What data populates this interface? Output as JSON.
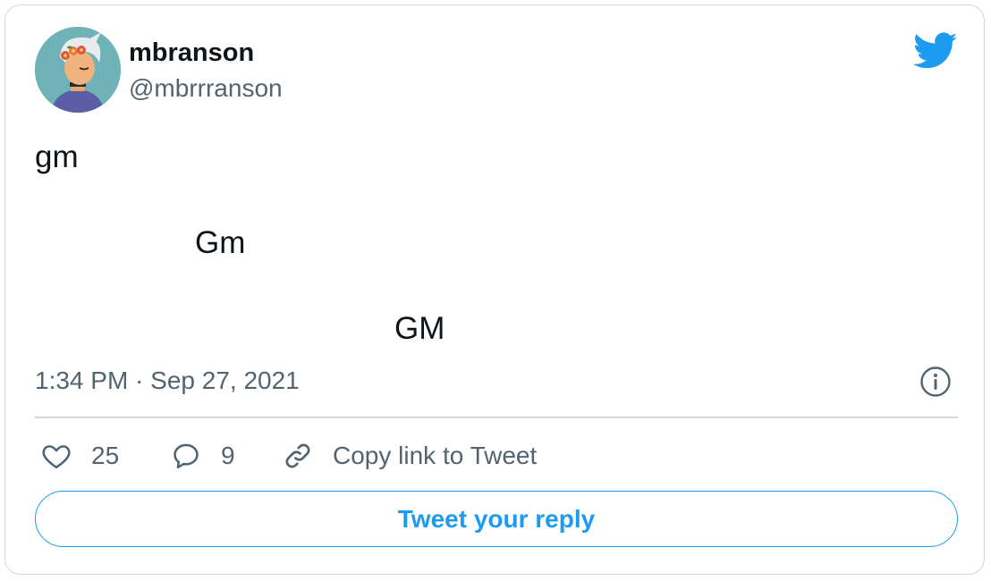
{
  "author": {
    "display_name": "mbranson",
    "handle": "@mbrrranson",
    "avatar_icon": "avatar-image"
  },
  "brand": {
    "icon": "twitter-bird-icon",
    "color": "#1d9bf0"
  },
  "tweet": {
    "lines": [
      "gm",
      "Gm",
      "GM"
    ],
    "timestamp": "1:34 PM · Sep 27, 2021"
  },
  "actions": {
    "likes": {
      "icon": "heart-icon",
      "count": "25"
    },
    "replies": {
      "icon": "speech-bubble-icon",
      "count": "9"
    },
    "copy_link": {
      "icon": "link-icon",
      "label": "Copy link to Tweet"
    }
  },
  "info_icon": "info-icon",
  "reply_button_label": "Tweet your reply",
  "colors": {
    "text": "#0f1419",
    "muted": "#536471",
    "border": "#cfd9de",
    "accent": "#1d9bf0"
  }
}
